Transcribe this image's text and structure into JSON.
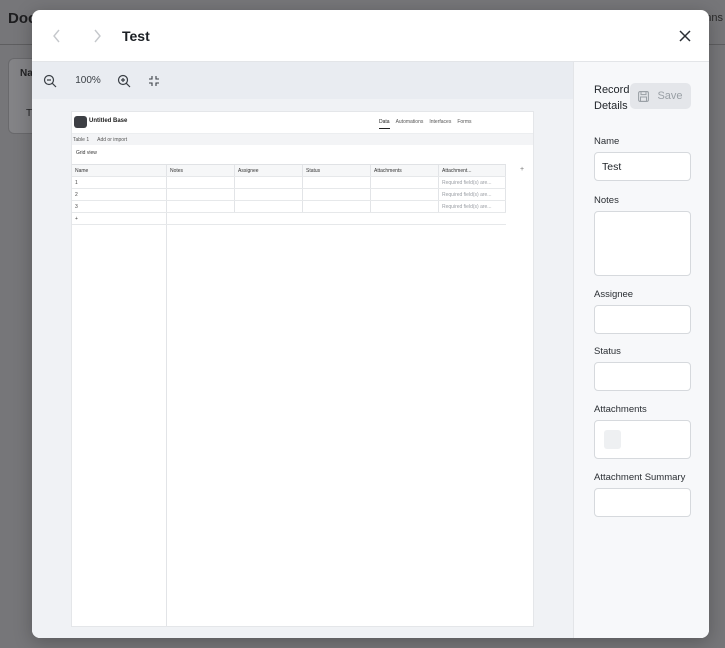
{
  "background": {
    "title": "Doc",
    "right_fragment": "mns",
    "table_header": "Na",
    "table_cell": "T"
  },
  "modal": {
    "title": "Test",
    "prev_icon": "chevron-left-icon",
    "next_icon": "chevron-right-icon",
    "close_icon": "close-icon"
  },
  "viewer": {
    "zoom_level": "100%",
    "tools": [
      "zoom-out-icon",
      "zoom-in-icon",
      "fit-to-page-icon"
    ],
    "document": {
      "base_name": "Untitled Base",
      "tabs": [
        "Data",
        "Automations",
        "Interfaces",
        "Forms"
      ],
      "table_name": "Table 1",
      "add_import": "Add or import",
      "view_name": "Grid view",
      "columns": [
        "Name",
        "Notes",
        "Assignee",
        "Status",
        "Attachments",
        "Attachment..."
      ],
      "rows": [
        {
          "num": "1",
          "summary": "Required field(s) are..."
        },
        {
          "num": "2",
          "summary": "Required field(s) are..."
        },
        {
          "num": "3",
          "summary": "Required field(s) are..."
        }
      ],
      "add_row": "+",
      "add_column": "+"
    }
  },
  "panel": {
    "title": "Record Details",
    "save_label": "Save",
    "fields": {
      "name_label": "Name",
      "name_value": "Test",
      "notes_label": "Notes",
      "assignee_label": "Assignee",
      "status_label": "Status",
      "attachments_label": "Attachments",
      "attachment_summary_label": "Attachment Summary"
    }
  }
}
